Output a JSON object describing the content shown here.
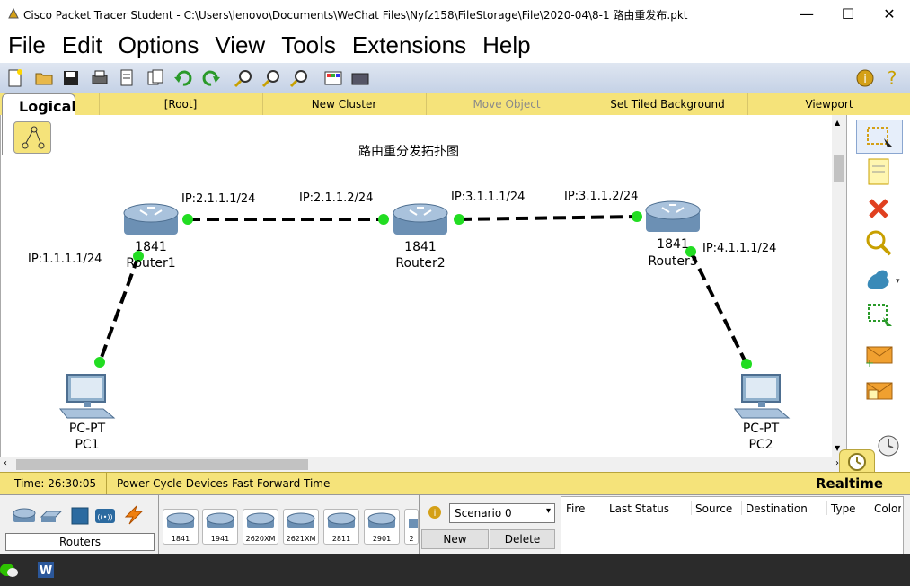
{
  "window": {
    "title": "Cisco Packet Tracer Student - C:\\Users\\lenovo\\Documents\\WeChat Files\\Nyfz158\\FileStorage\\File\\2020-04\\8-1 路由重发布.pkt",
    "minimize": "—",
    "maximize": "☐",
    "close": "✕"
  },
  "menu": [
    "File",
    "Edit",
    "Options",
    "View",
    "Tools",
    "Extensions",
    "Help"
  ],
  "logical_bar": {
    "tab": "Logical",
    "root": "[Root]",
    "new_cluster": "New Cluster",
    "move_object": "Move Object",
    "set_tiled_background": "Set Tiled Background",
    "viewport": "Viewport"
  },
  "workspace": {
    "note": "路由重分发拓扑图",
    "devices": [
      {
        "model": "1841",
        "name": "Router1"
      },
      {
        "model": "1841",
        "name": "Router2"
      },
      {
        "model": "1841",
        "name": "Router3"
      },
      {
        "model": "PC-PT",
        "name": "PC1"
      },
      {
        "model": "PC-PT",
        "name": "PC2"
      }
    ],
    "ip_labels": [
      "IP:2.1.1.1/24",
      "IP:2.1.1.2/24",
      "IP:3.1.1.1/24",
      "IP:3.1.1.2/24",
      "IP:1.1.1.1/24",
      "IP:4.1.1.1/24"
    ]
  },
  "statusbar": {
    "time": "Time: 26:30:05",
    "power_cycle": "Power Cycle Devices",
    "fast_forward": "Fast Forward Time",
    "mode": "Realtime"
  },
  "device_panel": {
    "category": "Routers",
    "models": [
      "1841",
      "1941",
      "2620XM",
      "2621XM",
      "2811",
      "2901",
      "2"
    ]
  },
  "scenario": {
    "selected": "Scenario 0",
    "new": "New",
    "delete": "Delete"
  },
  "pdu_table": {
    "columns": [
      "Fire",
      "Last Status",
      "Source",
      "Destination",
      "Type",
      "Color"
    ]
  },
  "colors": {
    "accent_yellow": "#f5e37a",
    "toolbar_blue": "#c5d2e6",
    "link_endpoint": "#22dd22"
  }
}
